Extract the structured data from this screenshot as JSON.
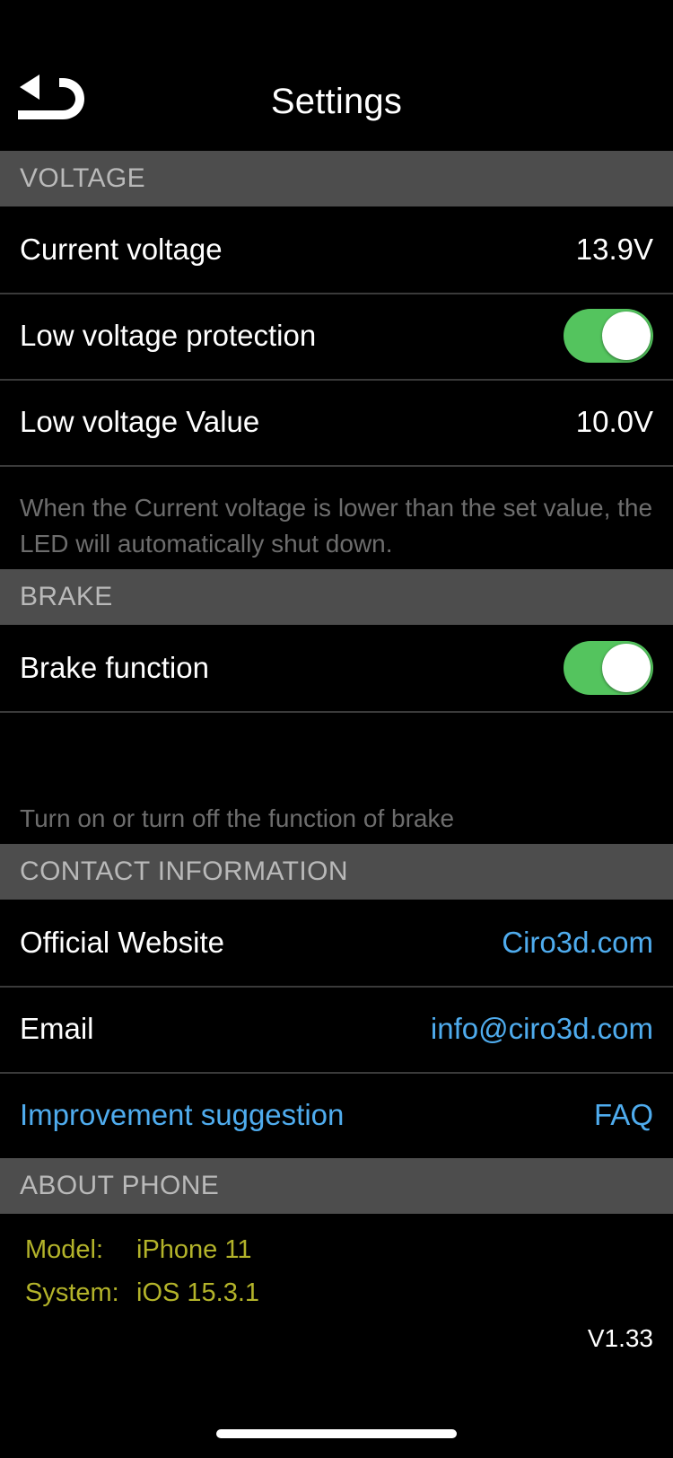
{
  "navbar": {
    "title": "Settings",
    "back_icon": "undo-arrow-icon"
  },
  "colors": {
    "screen_bg": "#000000",
    "section_header_bg": "#4d4d4d",
    "section_header_text": "#b9b9b9",
    "toggle_on": "#54c45e",
    "link_blue": "#4facee",
    "about_yellow": "#b3b32a",
    "footnote_gray": "#6d6d6d",
    "separator": "#3a3a3a"
  },
  "sections": {
    "voltage": {
      "header": "VOLTAGE",
      "rows": {
        "current_voltage": {
          "label": "Current voltage",
          "value": "13.9V"
        },
        "low_voltage_protection": {
          "label": "Low voltage protection",
          "toggle_state": "on"
        },
        "low_voltage_value": {
          "label": "Low voltage Value",
          "value": "10.0V"
        }
      },
      "footnote": "When the Current voltage is lower than the set value, the LED will automatically shut down."
    },
    "brake": {
      "header": "BRAKE",
      "rows": {
        "brake_function": {
          "label": "Brake function",
          "toggle_state": "on"
        }
      },
      "footnote": "Turn on or turn off the function of brake"
    },
    "contact": {
      "header": "CONTACT INFORMATION",
      "rows": {
        "official_website": {
          "label": "Official Website",
          "value": "Ciro3d.com"
        },
        "email": {
          "label": "Email",
          "value": "info@ciro3d.com"
        },
        "suggestion": {
          "label": "Improvement suggestion",
          "value": "FAQ"
        }
      }
    },
    "about_phone": {
      "header": "ABOUT PHONE",
      "model_key": "Model:",
      "model_value": "iPhone 11",
      "system_key": "System:",
      "system_value": "iOS 15.3.1",
      "version": "V1.33"
    }
  }
}
